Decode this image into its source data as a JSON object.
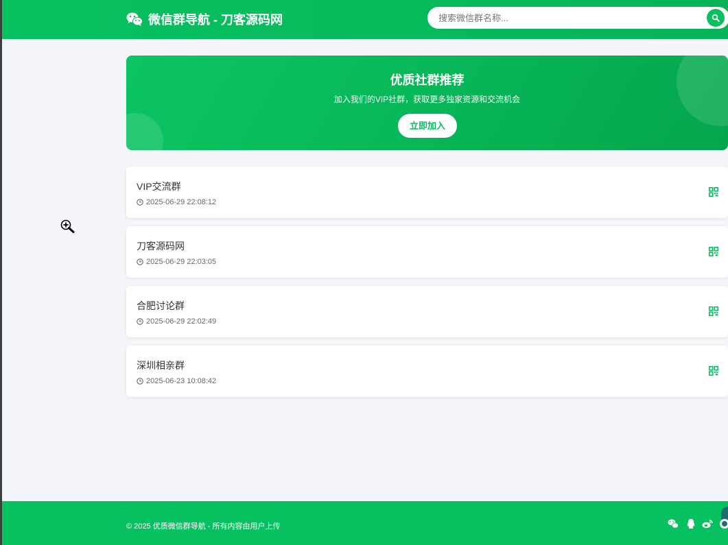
{
  "header": {
    "brand_title": "微信群导航 - 刀客源码网",
    "search_placeholder": "搜索微信群名称..."
  },
  "hero": {
    "title": "优质社群推荐",
    "subtitle": "加入我们的VIP社群，获取更多独家资源和交流机会",
    "button_label": "立即加入"
  },
  "groups": [
    {
      "name": "VIP交流群",
      "time": "2025-06-29 22:08:12"
    },
    {
      "name": "刀客源码网",
      "time": "2025-06-29 22:03:05"
    },
    {
      "name": "合肥讨论群",
      "time": "2025-06-29 22:02:49"
    },
    {
      "name": "深圳相亲群",
      "time": "2025-06-23 10:08:42"
    }
  ],
  "footer": {
    "copyright": "© 2025 优质微信群导航 - 所有内容由用户上传",
    "social_icons": [
      "wechat-icon",
      "qq-icon",
      "weibo-icon",
      "qrcode-icon"
    ]
  },
  "colors": {
    "brand_green": "#07c160",
    "background": "#f4f5f9"
  }
}
